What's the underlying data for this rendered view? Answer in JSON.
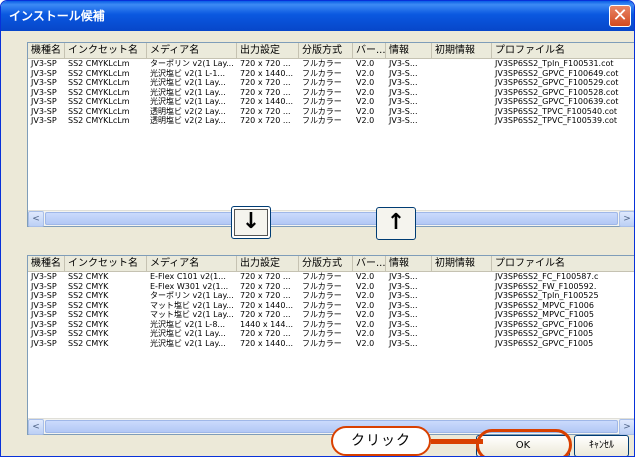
{
  "window": {
    "title": "インストール候補",
    "close_glyph": "✕"
  },
  "columns": [
    "機種名",
    "インクセット名",
    "メディア名",
    "出力設定",
    "分版方式",
    "バー...",
    "情報",
    "初期情報",
    "プロファイル名"
  ],
  "top_rows": [
    [
      "JV3-SP",
      "SS2 CMYKLcLm",
      "ターポリン v2(1 Lay...",
      "720 x 720 ...",
      "フルカラー",
      "V2.0",
      "JV3-S...",
      "",
      "JV3SP6SS2_Tpln_F100531.cot"
    ],
    [
      "JV3-SP",
      "SS2 CMYKLcLm",
      "光沢塩ビ v2(1 L-1...",
      "720 x 1440...",
      "フルカラー",
      "V2.0",
      "JV3-S...",
      "",
      "JV3SP6SS2_GPVC_F100649.cot"
    ],
    [
      "JV3-SP",
      "SS2 CMYKLcLm",
      "光沢塩ビ v2(1 Lay...",
      "720 x 720 ...",
      "フルカラー",
      "V2.0",
      "JV3-S...",
      "",
      "JV3SP6SS2_GPVC_F100529.cot"
    ],
    [
      "JV3-SP",
      "SS2 CMYKLcLm",
      "光沢塩ビ v2(1 Lay...",
      "720 x 720 ...",
      "フルカラー",
      "V2.0",
      "JV3-S...",
      "",
      "JV3SP6SS2_GPVC_F100528.cot"
    ],
    [
      "JV3-SP",
      "SS2 CMYKLcLm",
      "光沢塩ビ v2(1 Lay...",
      "720 x 1440...",
      "フルカラー",
      "V2.0",
      "JV3-S...",
      "",
      "JV3SP6SS2_GPVC_F100639.cot"
    ],
    [
      "JV3-SP",
      "SS2 CMYKLcLm",
      "透明塩ビ v2(2 Lay...",
      "720 x 720 ...",
      "フルカラー",
      "V2.0",
      "JV3-S...",
      "",
      "JV3SP6SS2_TPVC_F100540.cot"
    ],
    [
      "JV3-SP",
      "SS2 CMYKLcLm",
      "透明塩ビ v2(2 Lay...",
      "720 x 720 ...",
      "フルカラー",
      "V2.0",
      "JV3-S...",
      "",
      "JV3SP6SS2_TPVC_F100539.cot"
    ]
  ],
  "bottom_rows": [
    [
      "JV3-SP",
      "SS2 CMYK",
      "E-Flex C101 v2(1...",
      "720 x 720 ...",
      "フルカラー",
      "V2.0",
      "JV3-S...",
      "",
      "JV3SP6SS2_FC_F100587.c"
    ],
    [
      "JV3-SP",
      "SS2 CMYK",
      "E-Flex W301 v2(1...",
      "720 x 720 ...",
      "フルカラー",
      "V2.0",
      "JV3-S...",
      "",
      "JV3SP6SS2_FW_F100592."
    ],
    [
      "JV3-SP",
      "SS2 CMYK",
      "ターポリン v2(1 Lay...",
      "720 x 720 ...",
      "フルカラー",
      "V2.0",
      "JV3-S...",
      "",
      "JV3SP6SS2_Tpln_F100525"
    ],
    [
      "JV3-SP",
      "SS2 CMYK",
      "マット塩ビ v2(1 Lay...",
      "720 x 1440...",
      "フルカラー",
      "V2.0",
      "JV3-S...",
      "",
      "JV3SP6SS2_MPVC_F1006"
    ],
    [
      "JV3-SP",
      "SS2 CMYK",
      "マット塩ビ v2(1 Lay...",
      "720 x 720 ...",
      "フルカラー",
      "V2.0",
      "JV3-S...",
      "",
      "JV3SP6SS2_MPVC_F1005"
    ],
    [
      "JV3-SP",
      "SS2 CMYK",
      "光沢塩ビ v2(1 L-8...",
      "1440 x 144...",
      "フルカラー",
      "V2.0",
      "JV3-S...",
      "",
      "JV3SP6SS2_GPVC_F1006"
    ],
    [
      "JV3-SP",
      "SS2 CMYK",
      "光沢塩ビ v2(1 Lay...",
      "720 x 720 ...",
      "フルカラー",
      "V2.0",
      "JV3-S...",
      "",
      "JV3SP6SS2_GPVC_F1005"
    ],
    [
      "JV3-SP",
      "SS2 CMYK",
      "光沢塩ビ v2(1 Lay...",
      "720 x 1440...",
      "フルカラー",
      "V2.0",
      "JV3-S...",
      "",
      "JV3SP6SS2_GPVC_F1005"
    ]
  ],
  "buttons": {
    "down": "↓",
    "up": "↑",
    "ok": "OK",
    "cancel": "ｷｬﾝｾﾙ"
  },
  "scroll": {
    "left": "<",
    "right": ">"
  },
  "callout": {
    "text": "クリック",
    "color": "#d94000"
  }
}
